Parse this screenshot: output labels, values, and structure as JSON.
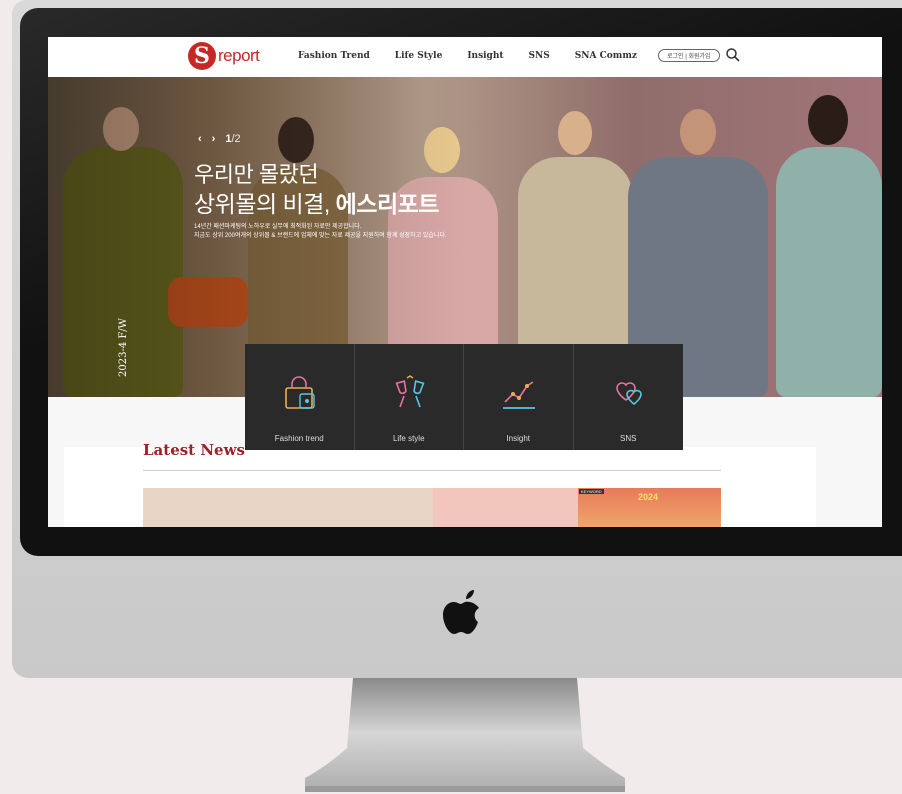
{
  "site": {
    "logo_text": "report",
    "logo_mark": "S",
    "nav": [
      "Fashion Trend",
      "Life Style",
      "Insight",
      "SNS",
      "SNA Commz"
    ],
    "login_text": "로그인 | 회원가입",
    "search_icon": "search-icon"
  },
  "hero": {
    "slide_current": "1",
    "slide_total": "/2",
    "prev_icon": "chevron-left-icon",
    "next_icon": "chevron-right-icon",
    "title_line1": "우리만 몰랐던",
    "title_line2_plain": "상위몰의 비결, ",
    "title_line2_bold": "에스리포트",
    "desc_line1": "14년간 패션마케팅의 노하우로 실무에 최적화된 자료만 제공합니다.",
    "desc_line2": "지금도 상위 200여개의 상위몰 & 브랜드에 업체에 맞는 자료 제공을 지원하며 함께 성장하고 있습니다.",
    "season_label": "2023-4 F/W"
  },
  "categories": [
    {
      "label": "Fashion trend",
      "icon": "shopping-bag-icon"
    },
    {
      "label": "Life style",
      "icon": "wine-glasses-icon"
    },
    {
      "label": "Insight",
      "icon": "line-chart-icon"
    },
    {
      "label": "SNS",
      "icon": "hearts-icon"
    }
  ],
  "latest_news": {
    "title": "Latest News",
    "card3_tag": "KEYWORD",
    "card3_year": "2024"
  },
  "colors": {
    "brand_red": "#c62828",
    "category_bar_bg": "#2a2a2a",
    "news_title": "#a01e28"
  }
}
